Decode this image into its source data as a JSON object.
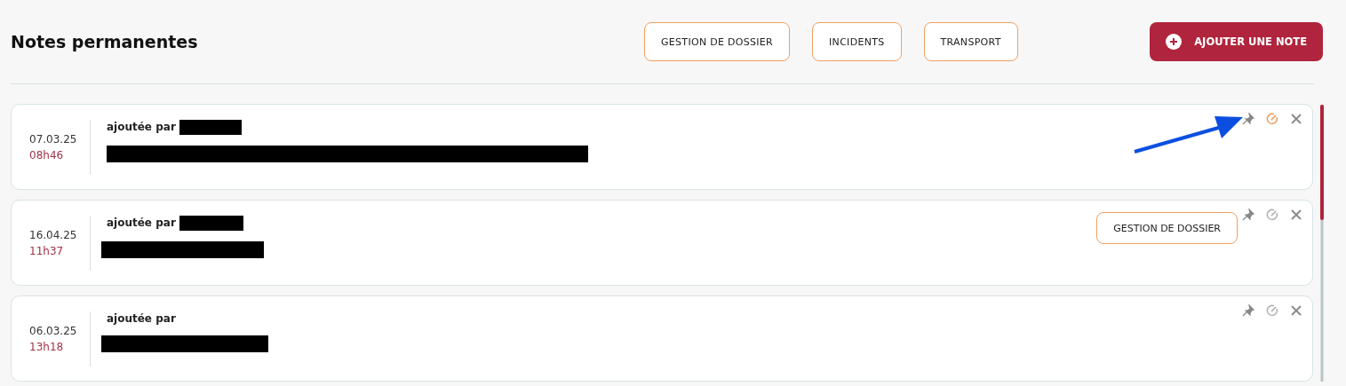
{
  "title": "Notes permanentes",
  "filters": [
    {
      "label": "GESTION DE DOSSIER"
    },
    {
      "label": "INCIDENTS"
    },
    {
      "label": "TRANSPORT"
    }
  ],
  "add_button": {
    "label": "AJOUTER UNE NOTE"
  },
  "notes": [
    {
      "date": "07.03.25",
      "time": "08h46",
      "author_label": "ajoutée par",
      "author_redacted": true,
      "body_redacted": true,
      "edit_highlighted": true,
      "pointer_arrow": true
    },
    {
      "date": "16.04.25",
      "time": "11h37",
      "author_label": "ajoutée par",
      "author_redacted": true,
      "body_redacted": true,
      "tag": "GESTION DE DOSSIER",
      "edit_highlighted": false,
      "pointer_arrow": false
    },
    {
      "date": "06.03.25",
      "time": "13h18",
      "author_label": "ajoutée par",
      "author_redacted": false,
      "body_redacted": true,
      "edit_highlighted": false,
      "pointer_arrow": false
    }
  ]
}
